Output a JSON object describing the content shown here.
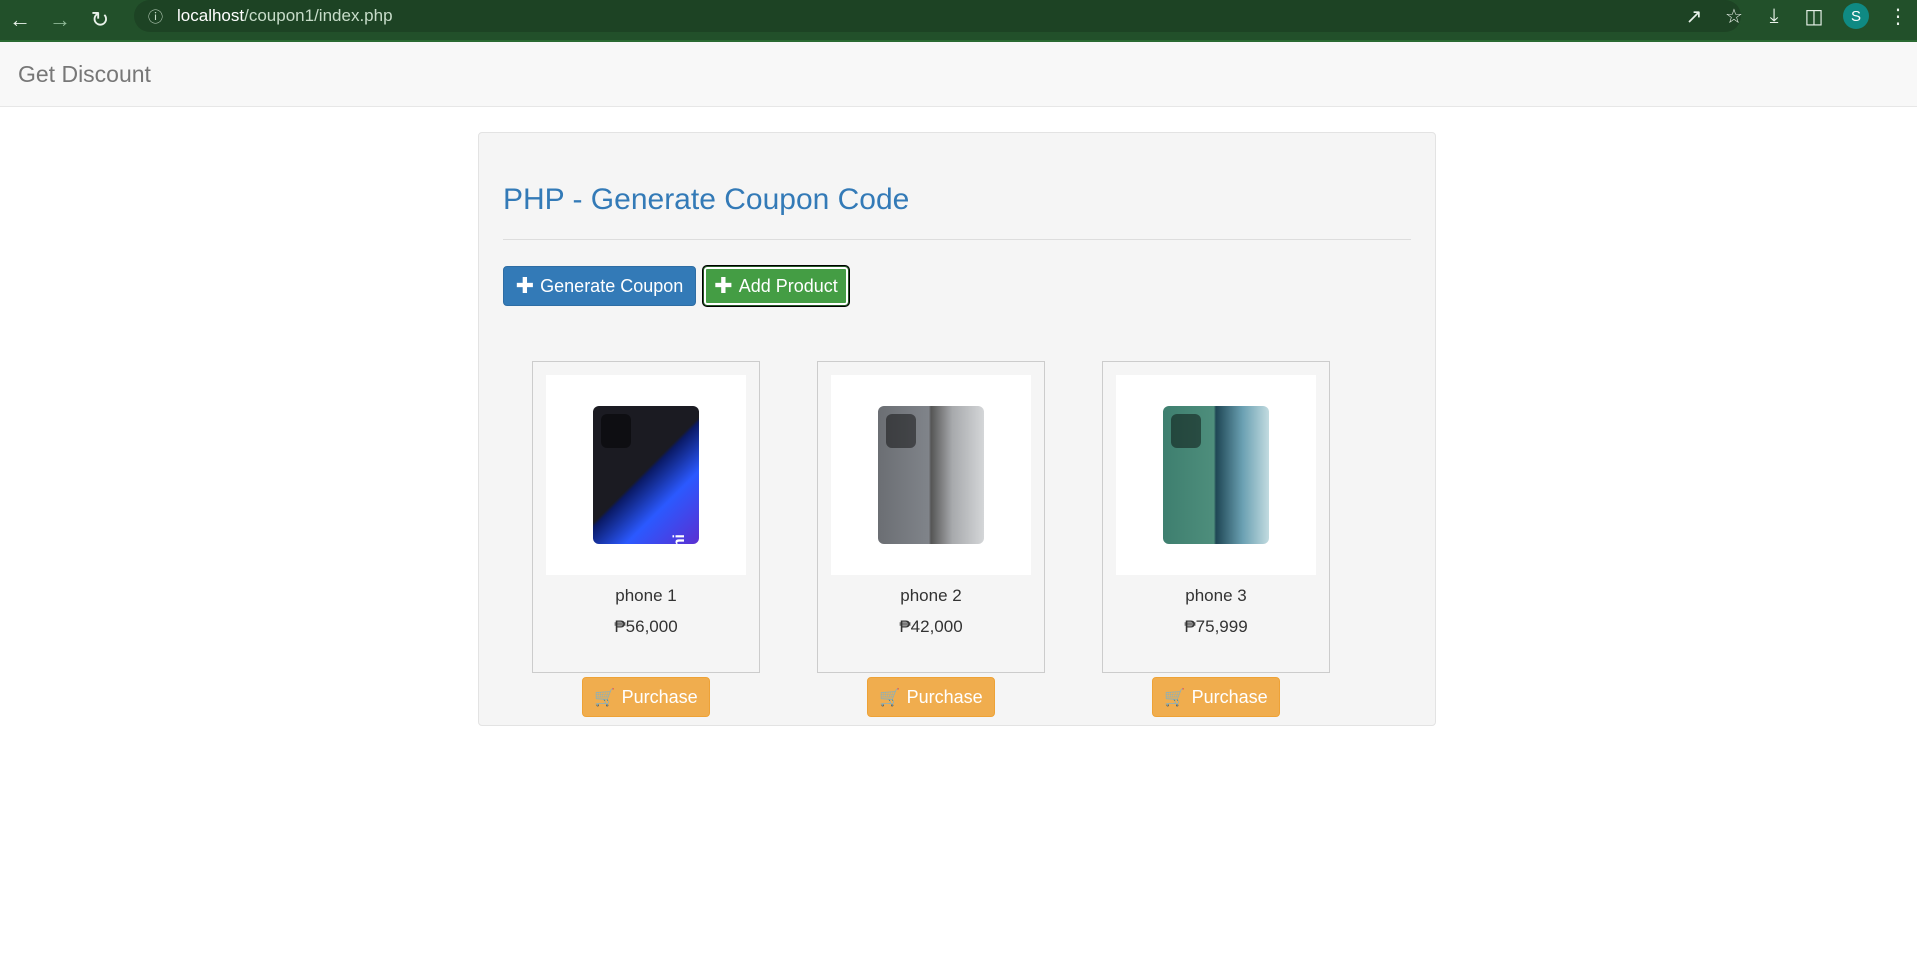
{
  "browser": {
    "url_host": "localhost",
    "url_path": "/coupon1/index.php",
    "avatar_letter": "S",
    "icons": [
      "back-icon",
      "forward-icon",
      "reload-icon",
      "info-icon",
      "share-icon",
      "star-icon",
      "download-icon",
      "sidebar-icon",
      "menu-icon"
    ]
  },
  "navbar": {
    "brand": "Get Discount"
  },
  "main": {
    "title": "PHP - Generate Coupon Code",
    "generate_label": "Generate Coupon",
    "add_label": "Add Product",
    "purchase_label": "Purchase"
  },
  "products": [
    {
      "name": "phone 1",
      "price": "₱56,000",
      "label": "Redmi"
    },
    {
      "name": "phone 2",
      "price": "₱42,000",
      "label": ""
    },
    {
      "name": "phone 3",
      "price": "₱75,999",
      "label": ""
    }
  ],
  "colors": {
    "primary": "#337ab7",
    "success": "#449d44",
    "warning": "#f0ad4e",
    "chrome": "#22502a"
  }
}
